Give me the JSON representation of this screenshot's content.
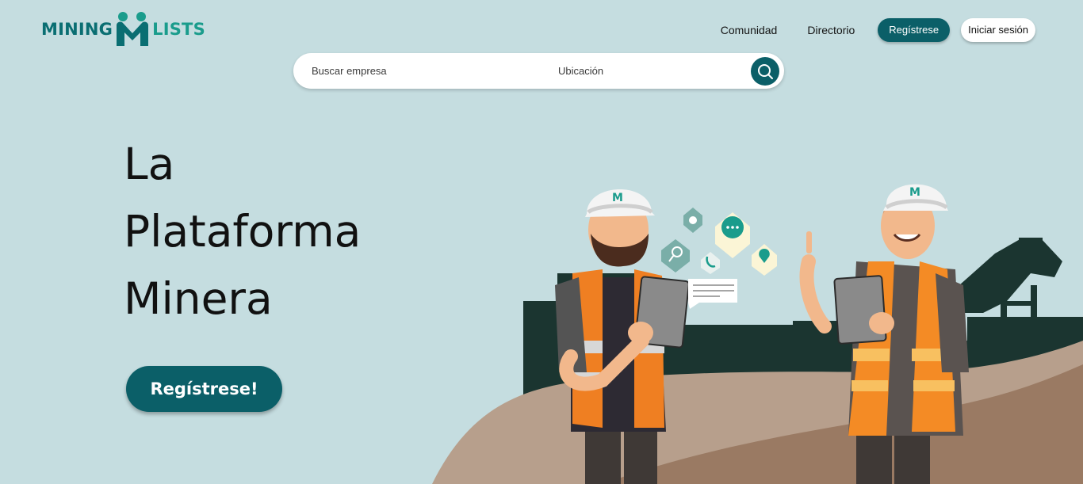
{
  "brand": {
    "name_left": "MINING",
    "name_right": "LISTS",
    "colors": {
      "primary": "#0b5f68",
      "accent": "#1a9c8c",
      "background": "#c5dde0"
    }
  },
  "nav": {
    "links": [
      "Comunidad",
      "Directorio"
    ],
    "register_label": "Regístrese",
    "login_label": "Iniciar sesión"
  },
  "search": {
    "company_placeholder": "Buscar empresa",
    "location_placeholder": "Ubicación",
    "button_icon": "search-icon"
  },
  "hero": {
    "title_lines": [
      "La",
      "Plataforma",
      "Minera"
    ],
    "cta_label": "Regístrese!"
  },
  "illustration": {
    "icons": [
      "gear-icon",
      "chat-icon",
      "search-icon",
      "location-pin-icon",
      "phone-icon",
      "message-card-icon"
    ]
  }
}
